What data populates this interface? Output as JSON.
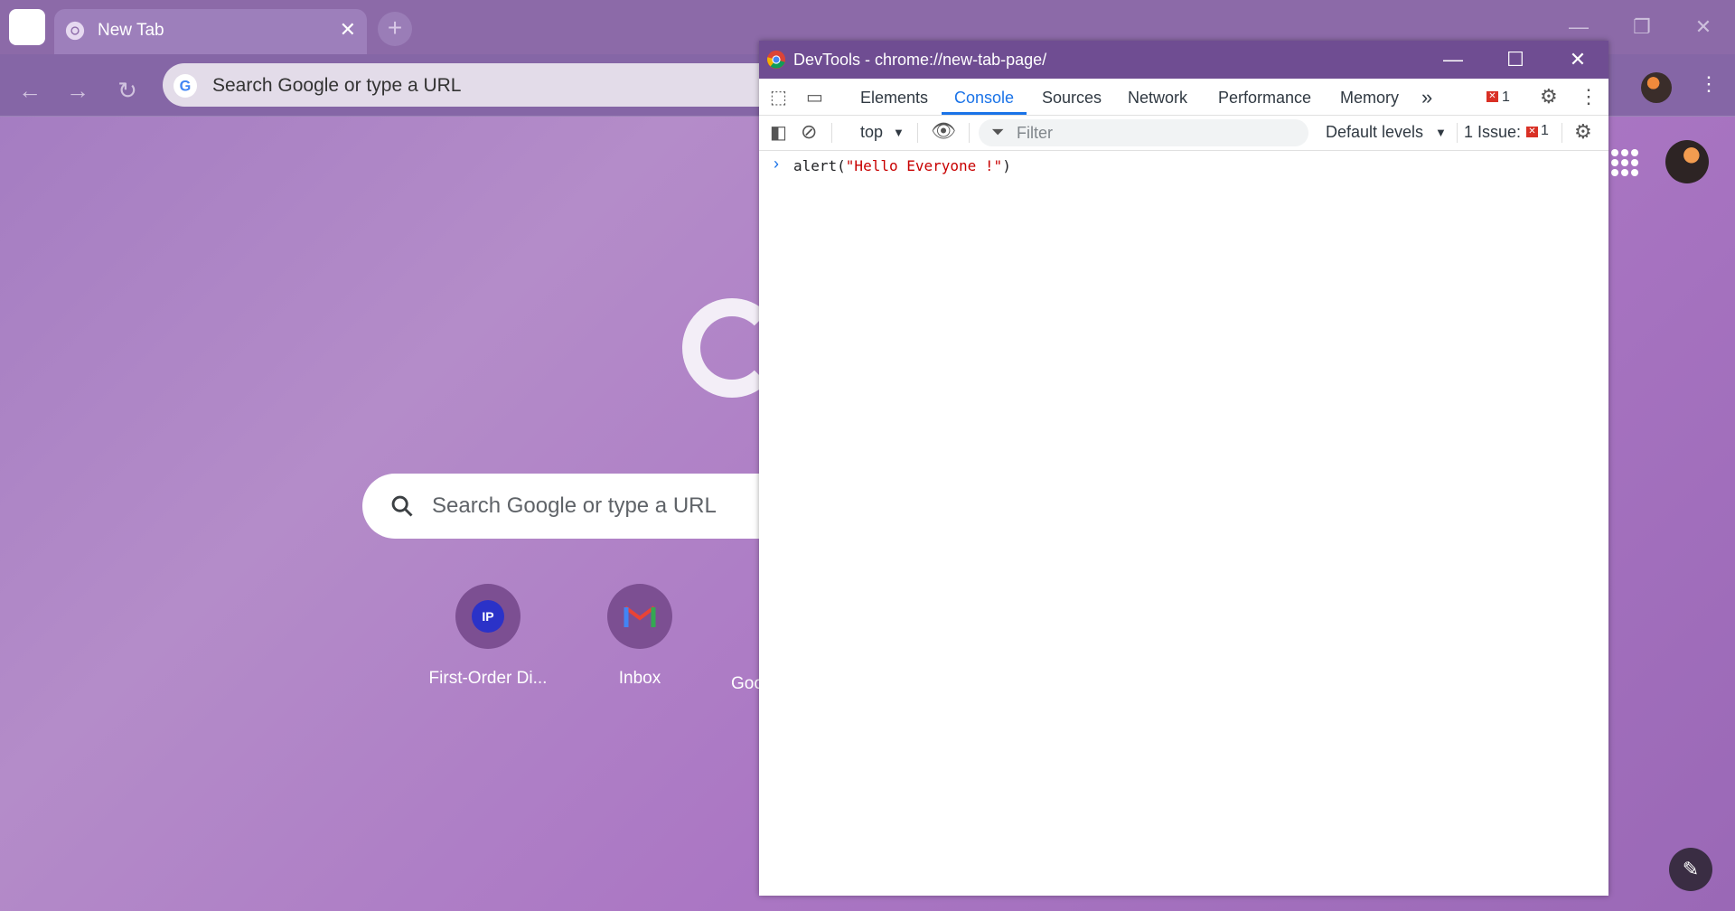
{
  "browser": {
    "tab_title": "New Tab",
    "tab_close": "✕",
    "new_tab": "+",
    "omnibox_placeholder": "Search Google or type a URL"
  },
  "ntp": {
    "search_placeholder": "Search Google or type a URL",
    "shortcuts": [
      {
        "label": "First-Order Di...",
        "badge": "IP"
      },
      {
        "label": "Inbox",
        "badge": "M"
      },
      {
        "label": "Goo"
      }
    ]
  },
  "devtools": {
    "window_title": "DevTools - chrome://new-tab-page/",
    "tabs": [
      "Elements",
      "Console",
      "Sources",
      "Network",
      "Performance",
      "Memory"
    ],
    "active_tab": "Console",
    "more_tabs": "»",
    "error_count": "1",
    "context": "top",
    "filter_placeholder": "Filter",
    "levels": "Default levels",
    "issues_label": "1 Issue:",
    "issues_count": "1",
    "console_input_prefix": "alert(",
    "console_input_string": "\"Hello Everyone !\"",
    "console_input_suffix": ")"
  },
  "colors": {
    "accent": "#1a73e8",
    "devtools_titlebar": "#6f4d92",
    "error": "#d93025"
  }
}
